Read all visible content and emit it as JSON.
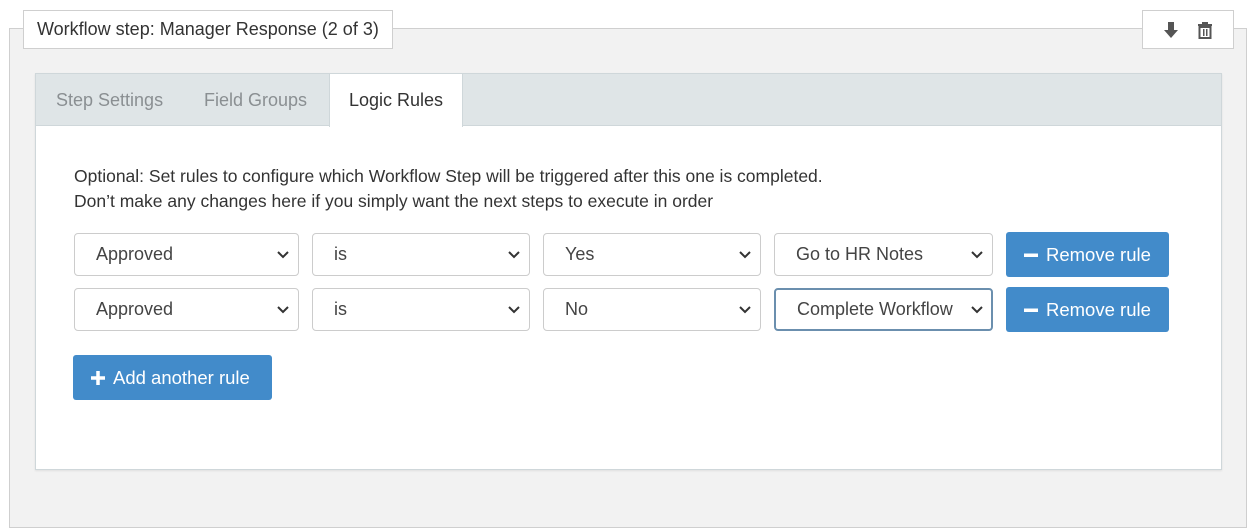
{
  "step": {
    "title": "Workflow step: Manager Response (2 of 3)",
    "actions": [
      {
        "name": "move-down-icon"
      },
      {
        "name": "trash-icon"
      }
    ]
  },
  "tabs": [
    {
      "label": "Step Settings",
      "active": false
    },
    {
      "label": "Field Groups",
      "active": false
    },
    {
      "label": "Logic Rules",
      "active": true
    }
  ],
  "logic": {
    "description_line1": "Optional: Set rules to configure which Workflow Step will be triggered after this one is completed.",
    "description_line2": "Don’t make any changes here if you simply want the next steps to execute in order",
    "rules": [
      {
        "field": "Approved",
        "operator": "is",
        "value": "Yes",
        "target": "Go to HR Notes",
        "remove_label": "Remove rule"
      },
      {
        "field": "Approved",
        "operator": "is",
        "value": "No",
        "target": "Complete Workflow",
        "remove_label": "Remove rule"
      }
    ],
    "add_label": "Add another rule"
  },
  "colors": {
    "primary_button": "#428bca",
    "tab_bar": "#dfe5e7",
    "panel_bg": "#f2f2f2",
    "focus_border": "#6b8fae"
  }
}
